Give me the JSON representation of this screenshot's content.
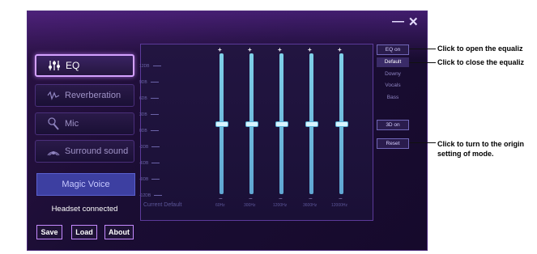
{
  "window": {
    "minimize_label": "—",
    "close_label": "✕"
  },
  "nav": [
    {
      "label": "EQ",
      "icon": "equalizer-icon"
    },
    {
      "label": "Reverberation",
      "icon": "waveform-icon"
    },
    {
      "label": "Mic",
      "icon": "microphone-icon"
    },
    {
      "label": "Surround sound",
      "icon": "surround-icon"
    }
  ],
  "magic_voice": "Magic Voice",
  "status": "Headset connected",
  "bottom_buttons": {
    "save": "Save",
    "load": "Load",
    "about": "About"
  },
  "eq": {
    "db_labels": [
      "12DB",
      "9DB",
      "6DB",
      "3DB",
      "0DB",
      "-3DB",
      "-6DB",
      "-9DB",
      "-12DB"
    ],
    "current_label": "Current Default",
    "plus": "+",
    "minus": "−",
    "bands": [
      {
        "freq": "60Hz",
        "gain_db": 0
      },
      {
        "freq": "300Hz",
        "gain_db": 0
      },
      {
        "freq": "1200Hz",
        "gain_db": 0
      },
      {
        "freq": "3600Hz",
        "gain_db": 0
      },
      {
        "freq": "12000Hz",
        "gain_db": 0
      }
    ]
  },
  "side": {
    "eq_on": "EQ on",
    "modes": [
      "Default",
      "Downy",
      "Vocals",
      "Bass"
    ],
    "selected_mode": "Default",
    "threed_on": "3D on",
    "reset": "Reset"
  },
  "callouts": {
    "open_eq": "Click to open the equaliz",
    "close_eq": "Click to close the equaliz",
    "reset_line1": "Click to turn to the origin",
    "reset_line2": "setting of mode."
  }
}
